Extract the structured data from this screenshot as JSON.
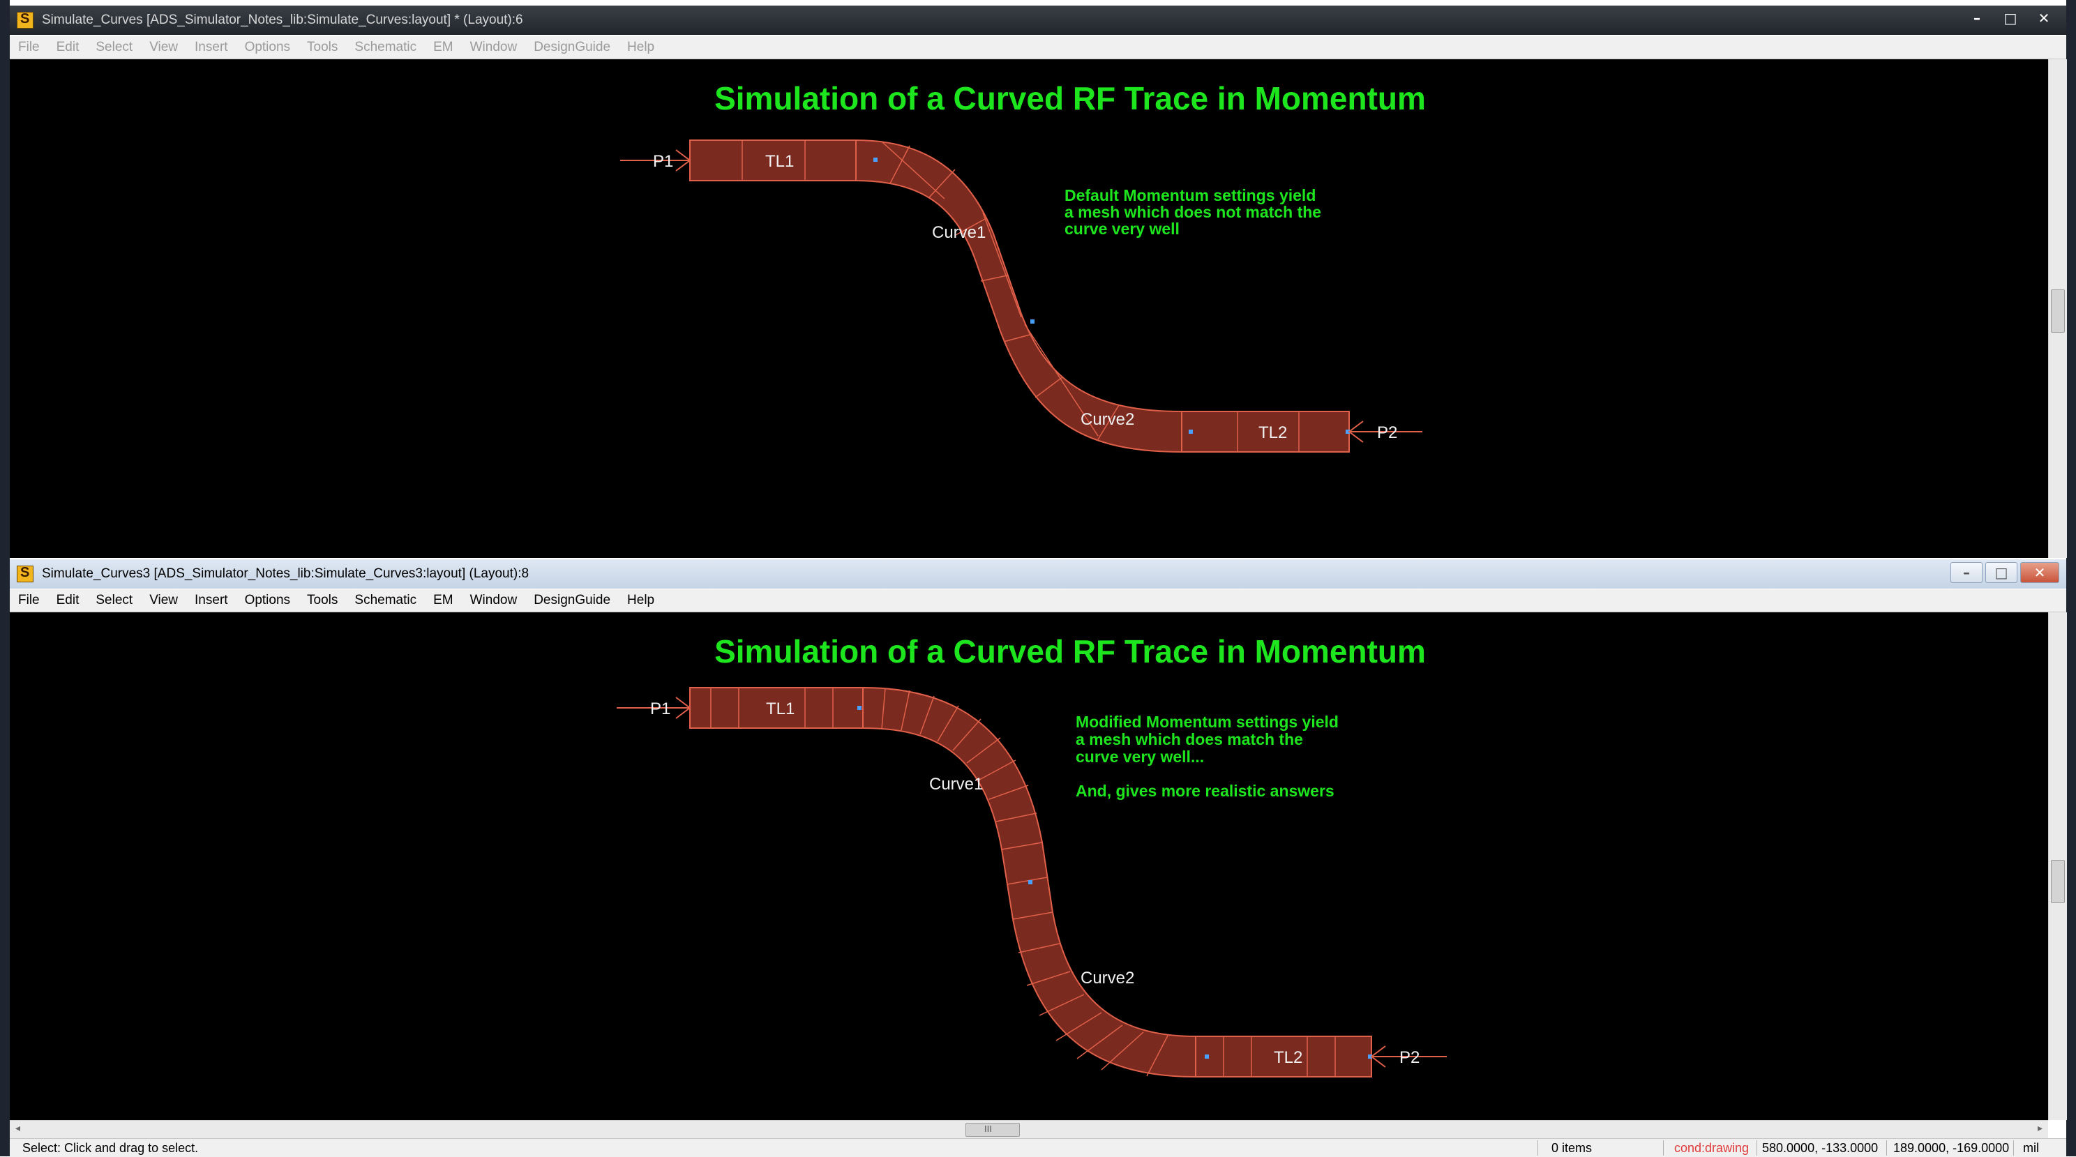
{
  "top_window": {
    "title": "Simulate_Curves [ADS_Simulator_Notes_lib:Simulate_Curves:layout] * (Layout):6",
    "menu": [
      "File",
      "Edit",
      "Select",
      "View",
      "Insert",
      "Options",
      "Tools",
      "Schematic",
      "EM",
      "Window",
      "DesignGuide",
      "Help"
    ],
    "heading": "Simulation of a Curved RF Trace in Momentum",
    "note_lines": [
      "Default Momentum settings yield",
      "a mesh which does not match the",
      "curve very well"
    ],
    "labels": {
      "p1": "P1",
      "tl1": "TL1",
      "curve1": "Curve1",
      "curve2": "Curve2",
      "tl2": "TL2",
      "p2": "P2"
    }
  },
  "bottom_window": {
    "title": "Simulate_Curves3 [ADS_Simulator_Notes_lib:Simulate_Curves3:layout] (Layout):8",
    "menu": [
      "File",
      "Edit",
      "Select",
      "View",
      "Insert",
      "Options",
      "Tools",
      "Schematic",
      "EM",
      "Window",
      "DesignGuide",
      "Help"
    ],
    "heading": "Simulation of a Curved RF Trace in Momentum",
    "note_lines": [
      "Modified Momentum settings yield",
      "a mesh which does match the",
      "curve very well...",
      "",
      "And, gives more realistic answers"
    ],
    "labels": {
      "p1": "P1",
      "tl1": "TL1",
      "curve1": "Curve1",
      "curve2": "Curve2",
      "tl2": "TL2",
      "p2": "P2"
    }
  },
  "window_controls": {
    "minimize": "–",
    "maximize": "□",
    "close": "✕"
  },
  "hscroll_grip": "III",
  "status": {
    "hint": "Select: Click and drag to select.",
    "items": "0 items",
    "layer": "cond:drawing",
    "coord1": "580.0000, -133.0000",
    "coord2": "189.0000, -169.0000",
    "units": "mil"
  },
  "colors": {
    "heading": "#1ee61e",
    "trace_fill": "#7a2a1e",
    "trace_edge": "#e0604a",
    "port_marker": "#4aa0ff",
    "label": "#f0f0f0",
    "status_layer": "#e03c3c"
  }
}
